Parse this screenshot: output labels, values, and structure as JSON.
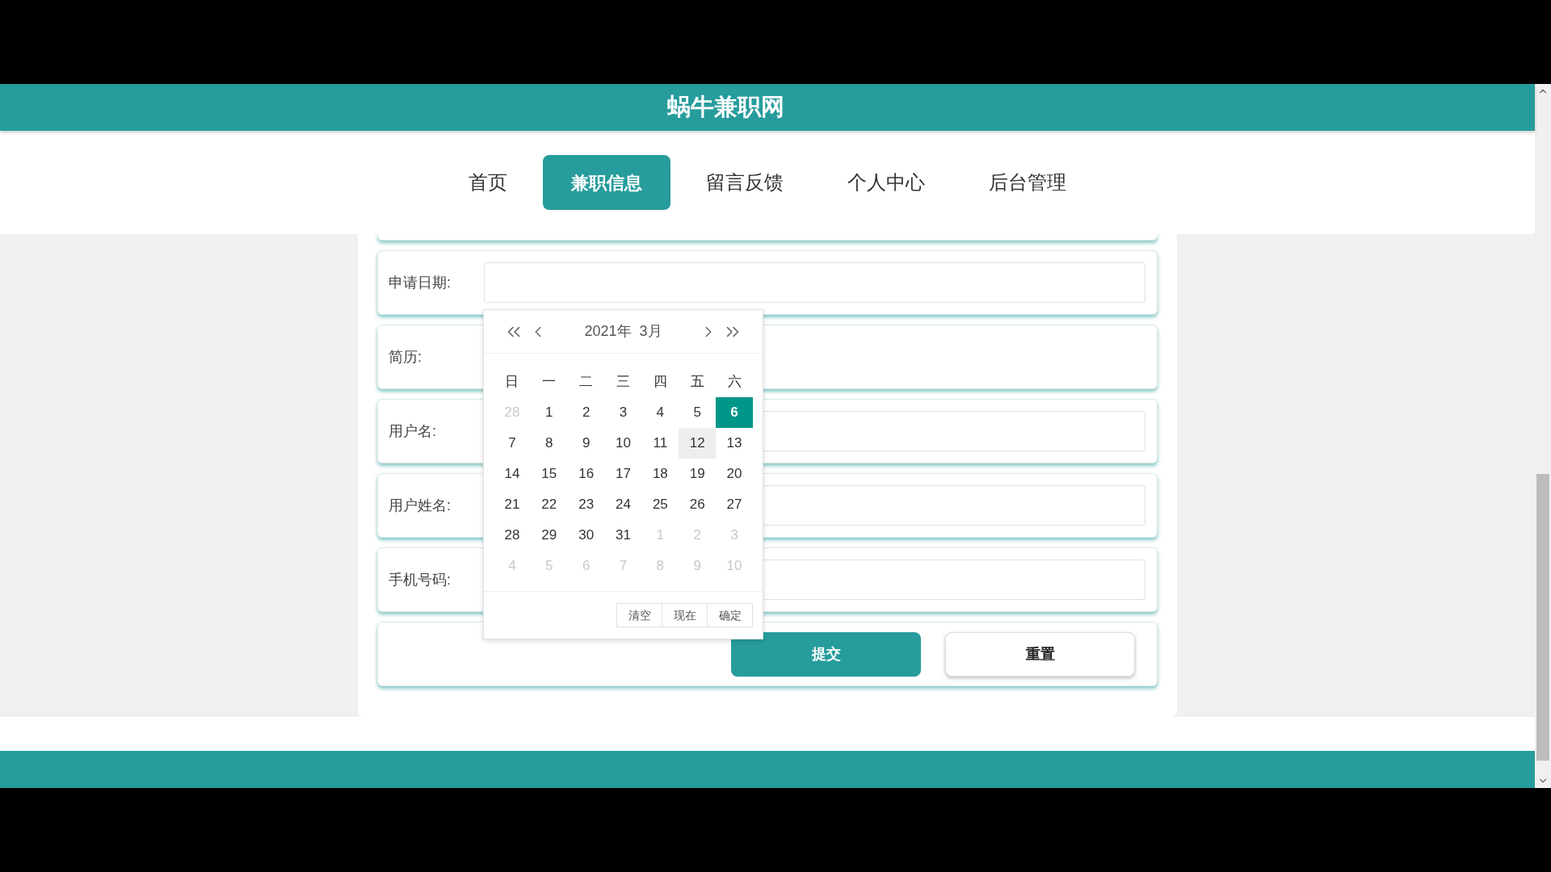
{
  "site_title": "蜗牛兼职网",
  "nav": [
    {
      "label": "首页",
      "selected": false
    },
    {
      "label": "兼职信息",
      "selected": true
    },
    {
      "label": "留言反馈",
      "selected": false
    },
    {
      "label": "个人中心",
      "selected": false
    },
    {
      "label": "后台管理",
      "selected": false
    }
  ],
  "form_rows": [
    {
      "label": "申请日期:",
      "kind": "input"
    },
    {
      "label": "简历:",
      "kind": "blank"
    },
    {
      "label": "用户名:",
      "kind": "input"
    },
    {
      "label": "用户姓名:",
      "kind": "input"
    },
    {
      "label": "手机号码:",
      "kind": "input"
    }
  ],
  "buttons": [
    {
      "label": "提交",
      "kind": "primary"
    },
    {
      "label": "重置",
      "kind": "secondary"
    }
  ],
  "date_picker": {
    "year": "2021年",
    "month": "3月",
    "weekdays": [
      "日",
      "一",
      "二",
      "三",
      "四",
      "五",
      "六"
    ],
    "days": [
      {
        "label": "28",
        "muted": true,
        "selected": false,
        "hovered": false
      },
      {
        "label": "1",
        "muted": false,
        "selected": false,
        "hovered": false
      },
      {
        "label": "2",
        "muted": false,
        "selected": false,
        "hovered": false
      },
      {
        "label": "3",
        "muted": false,
        "selected": false,
        "hovered": false
      },
      {
        "label": "4",
        "muted": false,
        "selected": false,
        "hovered": false
      },
      {
        "label": "5",
        "muted": false,
        "selected": false,
        "hovered": false
      },
      {
        "label": "6",
        "muted": false,
        "selected": true,
        "hovered": false
      },
      {
        "label": "7",
        "muted": false,
        "selected": false,
        "hovered": false
      },
      {
        "label": "8",
        "muted": false,
        "selected": false,
        "hovered": false
      },
      {
        "label": "9",
        "muted": false,
        "selected": false,
        "hovered": false
      },
      {
        "label": "10",
        "muted": false,
        "selected": false,
        "hovered": false
      },
      {
        "label": "11",
        "muted": false,
        "selected": false,
        "hovered": false
      },
      {
        "label": "12",
        "muted": false,
        "selected": false,
        "hovered": true
      },
      {
        "label": "13",
        "muted": false,
        "selected": false,
        "hovered": false
      },
      {
        "label": "14",
        "muted": false,
        "selected": false,
        "hovered": false
      },
      {
        "label": "15",
        "muted": false,
        "selected": false,
        "hovered": false
      },
      {
        "label": "16",
        "muted": false,
        "selected": false,
        "hovered": false
      },
      {
        "label": "17",
        "muted": false,
        "selected": false,
        "hovered": false
      },
      {
        "label": "18",
        "muted": false,
        "selected": false,
        "hovered": false
      },
      {
        "label": "19",
        "muted": false,
        "selected": false,
        "hovered": false
      },
      {
        "label": "20",
        "muted": false,
        "selected": false,
        "hovered": false
      },
      {
        "label": "21",
        "muted": false,
        "selected": false,
        "hovered": false
      },
      {
        "label": "22",
        "muted": false,
        "selected": false,
        "hovered": false
      },
      {
        "label": "23",
        "muted": false,
        "selected": false,
        "hovered": false
      },
      {
        "label": "24",
        "muted": false,
        "selected": false,
        "hovered": false
      },
      {
        "label": "25",
        "muted": false,
        "selected": false,
        "hovered": false
      },
      {
        "label": "26",
        "muted": false,
        "selected": false,
        "hovered": false
      },
      {
        "label": "27",
        "muted": false,
        "selected": false,
        "hovered": false
      },
      {
        "label": "28",
        "muted": false,
        "selected": false,
        "hovered": false
      },
      {
        "label": "29",
        "muted": false,
        "selected": false,
        "hovered": false
      },
      {
        "label": "30",
        "muted": false,
        "selected": false,
        "hovered": false
      },
      {
        "label": "31",
        "muted": false,
        "selected": false,
        "hovered": false
      },
      {
        "label": "1",
        "muted": true,
        "selected": false,
        "hovered": false
      },
      {
        "label": "2",
        "muted": true,
        "selected": false,
        "hovered": false
      },
      {
        "label": "3",
        "muted": true,
        "selected": false,
        "hovered": false
      },
      {
        "label": "4",
        "muted": true,
        "selected": false,
        "hovered": false
      },
      {
        "label": "5",
        "muted": true,
        "selected": false,
        "hovered": false
      },
      {
        "label": "6",
        "muted": true,
        "selected": false,
        "hovered": false
      },
      {
        "label": "7",
        "muted": true,
        "selected": false,
        "hovered": false
      },
      {
        "label": "8",
        "muted": true,
        "selected": false,
        "hovered": false
      },
      {
        "label": "9",
        "muted": true,
        "selected": false,
        "hovered": false
      },
      {
        "label": "10",
        "muted": true,
        "selected": false,
        "hovered": false
      }
    ],
    "actions": [
      "清空",
      "现在",
      "确定"
    ]
  }
}
